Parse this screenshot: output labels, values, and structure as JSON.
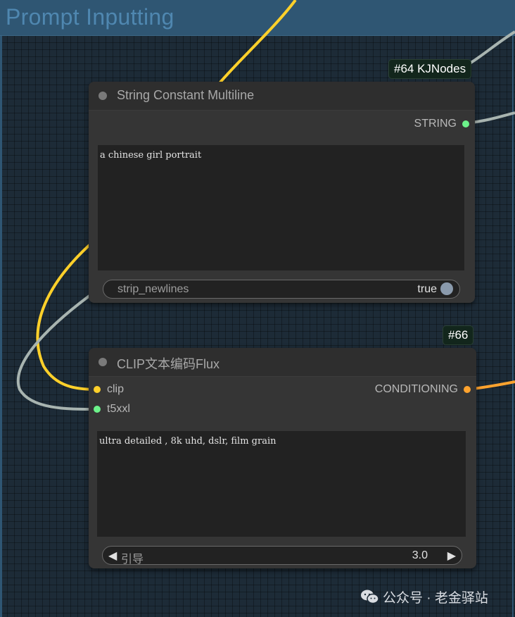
{
  "group": {
    "title": "Prompt Inputting"
  },
  "colors": {
    "string_wire": "#a8b4b0",
    "clip_wire": "#ffd02a",
    "conditioning_wire": "#ffa32e",
    "string_slot": "#6cf28a",
    "clip_slot": "#ffd02a",
    "conditioning_slot": "#ffa32e"
  },
  "node1": {
    "badge": "#64 KJNodes",
    "title": "String Constant Multiline",
    "output_label": "STRING",
    "text": "a chinese girl portrait",
    "widget_label": "strip_newlines",
    "widget_value": "true"
  },
  "node2": {
    "badge": "#66",
    "title": "CLIP文本编码Flux",
    "inputs": [
      "clip",
      "t5xxl"
    ],
    "output_label": "CONDITIONING",
    "text": "ultra detailed , 8k uhd, dslr, film grain",
    "widget_label": "引导",
    "widget_value": "3.0",
    "left_arrow": "◀",
    "right_arrow": "▶"
  },
  "watermark": {
    "text": "公众号 · 老金驿站",
    "icon": "wechat-icon"
  }
}
